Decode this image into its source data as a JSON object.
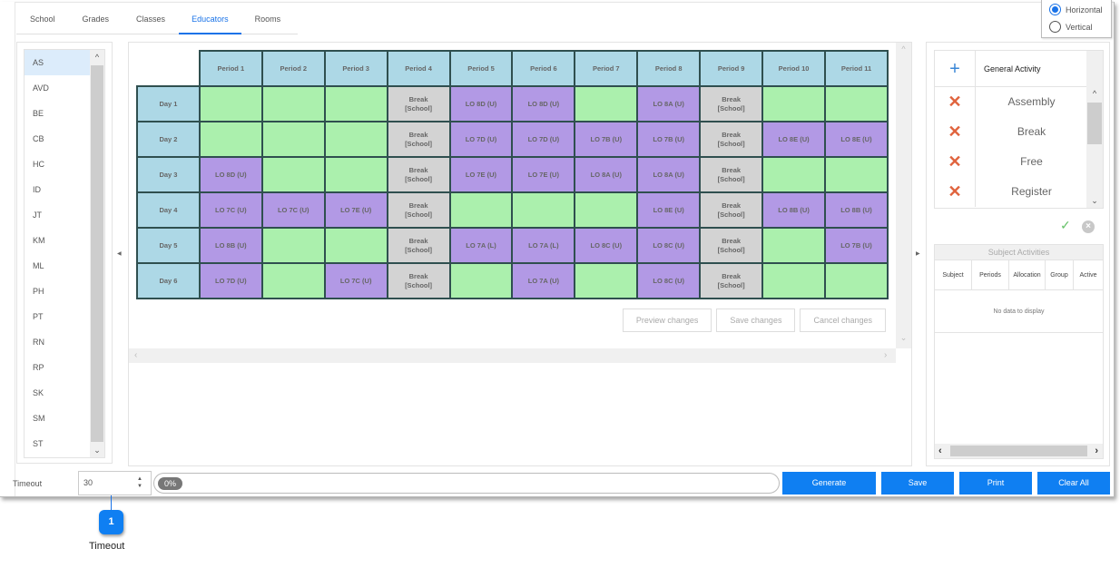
{
  "tabs": [
    {
      "label": "School",
      "active": false
    },
    {
      "label": "Grades",
      "active": false
    },
    {
      "label": "Classes",
      "active": false
    },
    {
      "label": "Educators",
      "active": true
    },
    {
      "label": "Rooms",
      "active": false
    }
  ],
  "orientation": {
    "options": [
      {
        "label": "Horizontal",
        "checked": true
      },
      {
        "label": "Vertical",
        "checked": false
      }
    ]
  },
  "educators": {
    "selected": "AS",
    "items": [
      "AS",
      "AVD",
      "BE",
      "CB",
      "HC",
      "ID",
      "JT",
      "KM",
      "ML",
      "PH",
      "PT",
      "RN",
      "RP",
      "SK",
      "SM",
      "ST"
    ]
  },
  "timetable": {
    "periods": [
      "Period 1",
      "Period 2",
      "Period 3",
      "Period 4",
      "Period 5",
      "Period 6",
      "Period 7",
      "Period 8",
      "Period 9",
      "Period 10",
      "Period 11"
    ],
    "days": [
      {
        "label": "Day 1",
        "cells": [
          {
            "type": "free",
            "text": ""
          },
          {
            "type": "free",
            "text": ""
          },
          {
            "type": "free",
            "text": ""
          },
          {
            "type": "break",
            "text": "Break",
            "sub": "[School]"
          },
          {
            "type": "lesson",
            "text": "LO 8D (U)"
          },
          {
            "type": "lesson",
            "text": "LO 8D (U)"
          },
          {
            "type": "free",
            "text": ""
          },
          {
            "type": "lesson",
            "text": "LO 8A (U)"
          },
          {
            "type": "break",
            "text": "Break",
            "sub": "[School]"
          },
          {
            "type": "free",
            "text": ""
          },
          {
            "type": "free",
            "text": ""
          }
        ]
      },
      {
        "label": "Day 2",
        "cells": [
          {
            "type": "free",
            "text": ""
          },
          {
            "type": "free",
            "text": ""
          },
          {
            "type": "free",
            "text": ""
          },
          {
            "type": "break",
            "text": "Break",
            "sub": "[School]"
          },
          {
            "type": "lesson",
            "text": "LO 7D (U)"
          },
          {
            "type": "lesson",
            "text": "LO 7D (U)"
          },
          {
            "type": "lesson",
            "text": "LO 7B (U)"
          },
          {
            "type": "lesson",
            "text": "LO 7B (U)"
          },
          {
            "type": "break",
            "text": "Break",
            "sub": "[School]"
          },
          {
            "type": "lesson",
            "text": "LO 8E (U)"
          },
          {
            "type": "lesson",
            "text": "LO 8E (U)"
          }
        ]
      },
      {
        "label": "Day 3",
        "cells": [
          {
            "type": "lesson",
            "text": "LO 8D (U)"
          },
          {
            "type": "free",
            "text": ""
          },
          {
            "type": "free",
            "text": ""
          },
          {
            "type": "break",
            "text": "Break",
            "sub": "[School]"
          },
          {
            "type": "lesson",
            "text": "LO 7E (U)"
          },
          {
            "type": "lesson",
            "text": "LO 7E (U)"
          },
          {
            "type": "lesson",
            "text": "LO 8A (U)"
          },
          {
            "type": "lesson",
            "text": "LO 8A (U)"
          },
          {
            "type": "break",
            "text": "Break",
            "sub": "[School]"
          },
          {
            "type": "free",
            "text": ""
          },
          {
            "type": "free",
            "text": ""
          }
        ]
      },
      {
        "label": "Day 4",
        "cells": [
          {
            "type": "lesson",
            "text": "LO 7C (U)"
          },
          {
            "type": "lesson",
            "text": "LO 7C (U)"
          },
          {
            "type": "lesson",
            "text": "LO 7E (U)"
          },
          {
            "type": "break",
            "text": "Break",
            "sub": "[School]"
          },
          {
            "type": "free",
            "text": ""
          },
          {
            "type": "free",
            "text": ""
          },
          {
            "type": "free",
            "text": ""
          },
          {
            "type": "lesson",
            "text": "LO 8E (U)"
          },
          {
            "type": "break",
            "text": "Break",
            "sub": "[School]"
          },
          {
            "type": "lesson",
            "text": "LO 8B (U)"
          },
          {
            "type": "lesson",
            "text": "LO 8B (U)"
          }
        ]
      },
      {
        "label": "Day 5",
        "cells": [
          {
            "type": "lesson",
            "text": "LO 8B (U)"
          },
          {
            "type": "free",
            "text": ""
          },
          {
            "type": "free",
            "text": ""
          },
          {
            "type": "break",
            "text": "Break",
            "sub": "[School]"
          },
          {
            "type": "lesson",
            "text": "LO 7A (L)"
          },
          {
            "type": "lesson",
            "text": "LO 7A (L)"
          },
          {
            "type": "lesson",
            "text": "LO 8C (U)"
          },
          {
            "type": "lesson",
            "text": "LO 8C (U)"
          },
          {
            "type": "break",
            "text": "Break",
            "sub": "[School]"
          },
          {
            "type": "free",
            "text": ""
          },
          {
            "type": "lesson",
            "text": "LO 7B (U)"
          }
        ]
      },
      {
        "label": "Day 6",
        "cells": [
          {
            "type": "lesson",
            "text": "LO 7D (U)"
          },
          {
            "type": "free",
            "text": ""
          },
          {
            "type": "lesson",
            "text": "LO 7C (U)"
          },
          {
            "type": "break",
            "text": "Break",
            "sub": "[School]"
          },
          {
            "type": "free",
            "text": ""
          },
          {
            "type": "lesson",
            "text": "LO 7A (U)"
          },
          {
            "type": "free",
            "text": ""
          },
          {
            "type": "lesson",
            "text": "LO 8C (U)"
          },
          {
            "type": "break",
            "text": "Break",
            "sub": "[School]"
          },
          {
            "type": "free",
            "text": ""
          },
          {
            "type": "free",
            "text": ""
          }
        ]
      }
    ],
    "colors": {
      "header": "#add8e6",
      "free": "#abf0ad",
      "lesson": "#b299e5",
      "break": "#d3d3d3",
      "border": "#2f4f4f"
    }
  },
  "change_buttons": {
    "preview": "Preview changes",
    "save": "Save changes",
    "cancel": "Cancel changes"
  },
  "general_activity": {
    "title": "General Activity",
    "items": [
      "Assembly",
      "Break",
      "Free",
      "Register"
    ]
  },
  "subject_activities": {
    "title": "Subject Activities",
    "columns": [
      "Subject",
      "Periods",
      "Allocation",
      "Group",
      "Active"
    ],
    "empty_text": "No data to display"
  },
  "footer": {
    "timeout_label": "Timeout",
    "timeout_value": "30",
    "progress_text": "0%",
    "progress_percent": 0,
    "buttons": {
      "generate": "Generate",
      "save": "Save",
      "print": "Print",
      "clear_all": "Clear All"
    },
    "accent": "#0f7ff2"
  },
  "callout": {
    "number": "1",
    "label": "Timeout"
  }
}
